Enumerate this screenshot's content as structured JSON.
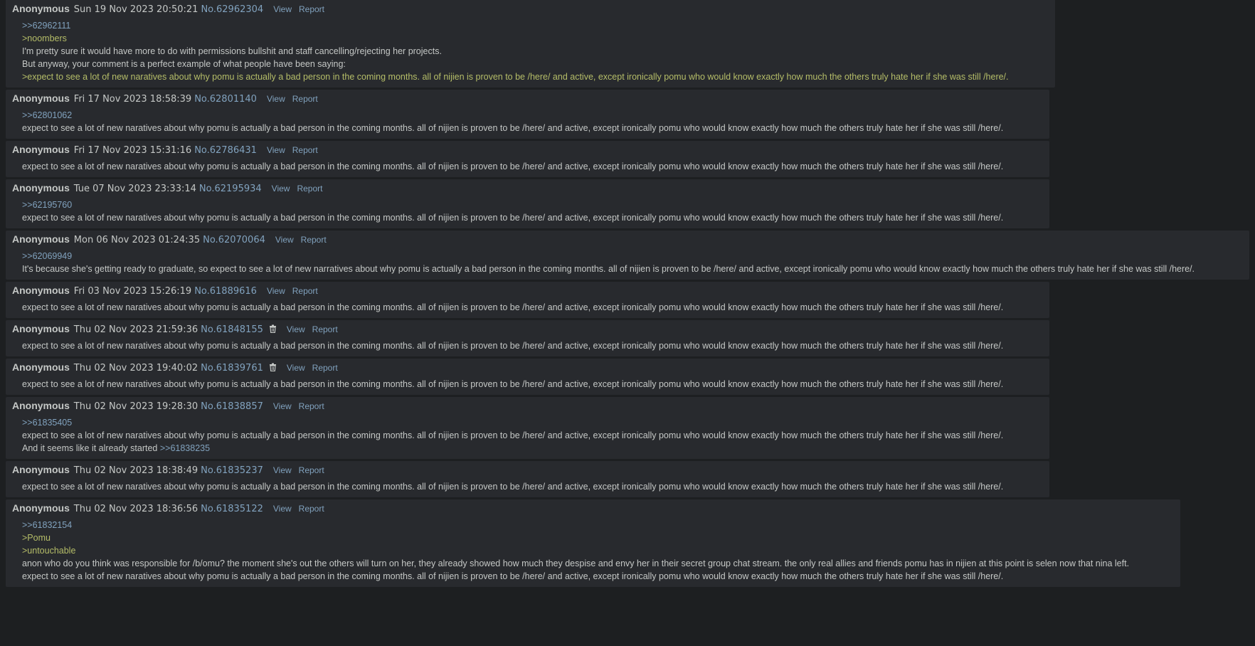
{
  "labels": {
    "view": "View",
    "report": "Report"
  },
  "posts": [
    {
      "name": "Anonymous",
      "date": "Sun 19 Nov 2023 20:50:21",
      "num": "No.62962304",
      "lines": [
        {
          "t": "quote",
          "text": ">>62962111"
        },
        {
          "t": "green",
          "text": ">noombers"
        },
        {
          "t": "text",
          "text": "I'm pretty sure it would have more to do with permissions bullshit and staff cancelling/rejecting her projects."
        },
        {
          "t": "text",
          "text": "But anyway, your comment is a perfect example of what people have been saying:"
        },
        {
          "t": "green",
          "text": ">expect to see a lot of new naratives about why pomu is actually a bad person in the coming months. all of nijien is proven to be /here/ and active, except ironically pomu who would know exactly how much the others truly hate her if she was still /here/."
        }
      ]
    },
    {
      "name": "Anonymous",
      "date": "Fri 17 Nov 2023 18:58:39",
      "num": "No.62801140",
      "lines": [
        {
          "t": "quote",
          "text": ">>62801062"
        },
        {
          "t": "text",
          "text": "expect to see a lot of new naratives about why pomu is actually a bad person in the coming months. all of nijien is proven to be /here/ and active, except ironically pomu who would know exactly how much the others truly hate her if she was still /here/."
        }
      ]
    },
    {
      "name": "Anonymous",
      "date": "Fri 17 Nov 2023 15:31:16",
      "num": "No.62786431",
      "lines": [
        {
          "t": "text",
          "text": "expect to see a lot of new naratives about why pomu is actually a bad person in the coming months. all of nijien is proven to be /here/ and active, except ironically pomu who would know exactly how much the others truly hate her if she was still /here/."
        }
      ]
    },
    {
      "name": "Anonymous",
      "date": "Tue 07 Nov 2023 23:33:14",
      "num": "No.62195934",
      "lines": [
        {
          "t": "quote",
          "text": ">>62195760"
        },
        {
          "t": "text",
          "text": "expect to see a lot of new naratives about why pomu is actually a bad person in the coming months. all of nijien is proven to be /here/ and active, except ironically pomu who would know exactly how much the others truly hate her if she was still /here/."
        }
      ]
    },
    {
      "name": "Anonymous",
      "date": "Mon 06 Nov 2023 01:24:35",
      "num": "No.62070064",
      "lines": [
        {
          "t": "quote",
          "text": ">>62069949"
        },
        {
          "t": "text",
          "text": "It's because she's getting ready to graduate, so expect to see a lot of new narratives about why pomu is actually a bad person in the coming months. all of nijien is proven to be /here/ and active, except ironically pomu who would know exactly how much the others truly hate her if she was still /here/."
        }
      ]
    },
    {
      "name": "Anonymous",
      "date": "Fri 03 Nov 2023 15:26:19",
      "num": "No.61889616",
      "lines": [
        {
          "t": "text",
          "text": "expect to see a lot of new naratives about why pomu is actually a bad person in the coming months. all of nijien is proven to be /here/ and active, except ironically pomu who would know exactly how much the others truly hate her if she was still /here/."
        }
      ]
    },
    {
      "name": "Anonymous",
      "date": "Thu 02 Nov 2023 21:59:36",
      "num": "No.61848155",
      "deleted": true,
      "lines": [
        {
          "t": "text",
          "text": "expect to see a lot of new naratives about why pomu is actually a bad person in the coming months. all of nijien is proven to be /here/ and active, except ironically pomu who would know exactly how much the others truly hate her if she was still /here/."
        }
      ]
    },
    {
      "name": "Anonymous",
      "date": "Thu 02 Nov 2023 19:40:02",
      "num": "No.61839761",
      "deleted": true,
      "lines": [
        {
          "t": "text",
          "text": "expect to see a lot of new naratives about why pomu is actually a bad person in the coming months. all of nijien is proven to be /here/ and active, except ironically pomu who would know exactly how much the others truly hate her if she was still /here/."
        }
      ]
    },
    {
      "name": "Anonymous",
      "date": "Thu 02 Nov 2023 19:28:30",
      "num": "No.61838857",
      "lines": [
        {
          "t": "quote",
          "text": ">>61835405"
        },
        {
          "t": "text",
          "text": "expect to see a lot of new naratives about why pomu is actually a bad person in the coming months. all of nijien is proven to be /here/ and active, except ironically pomu who would know exactly how much the others truly hate her if she was still /here/."
        },
        {
          "t": "mixed",
          "text": "And it seems like it already started ",
          "quote": ">>61838235"
        }
      ]
    },
    {
      "name": "Anonymous",
      "date": "Thu 02 Nov 2023 18:38:49",
      "num": "No.61835237",
      "lines": [
        {
          "t": "text",
          "text": "expect to see a lot of new naratives about why pomu is actually a bad person in the coming months. all of nijien is proven to be /here/ and active, except ironically pomu who would know exactly how much the others truly hate her if she was still /here/."
        }
      ]
    },
    {
      "name": "Anonymous",
      "date": "Thu 02 Nov 2023 18:36:56",
      "num": "No.61835122",
      "lines": [
        {
          "t": "quote",
          "text": ">>61832154"
        },
        {
          "t": "green",
          "text": ">Pomu"
        },
        {
          "t": "green",
          "text": ">untouchable"
        },
        {
          "t": "text",
          "text": "anon who do you think was responsible for /b/omu? the moment she's out the others will turn on her, they already showed how much they despise and envy her in their secret group chat stream. the only real allies and friends pomu has in nijien at this point is selen now that nina left."
        },
        {
          "t": "text",
          "text": "expect to see a lot of new naratives about why pomu is actually a bad person in the coming months. all of nijien is proven to be /here/ and active, except ironically pomu who would know exactly how much the others truly hate her if she was still /here/."
        }
      ]
    }
  ]
}
